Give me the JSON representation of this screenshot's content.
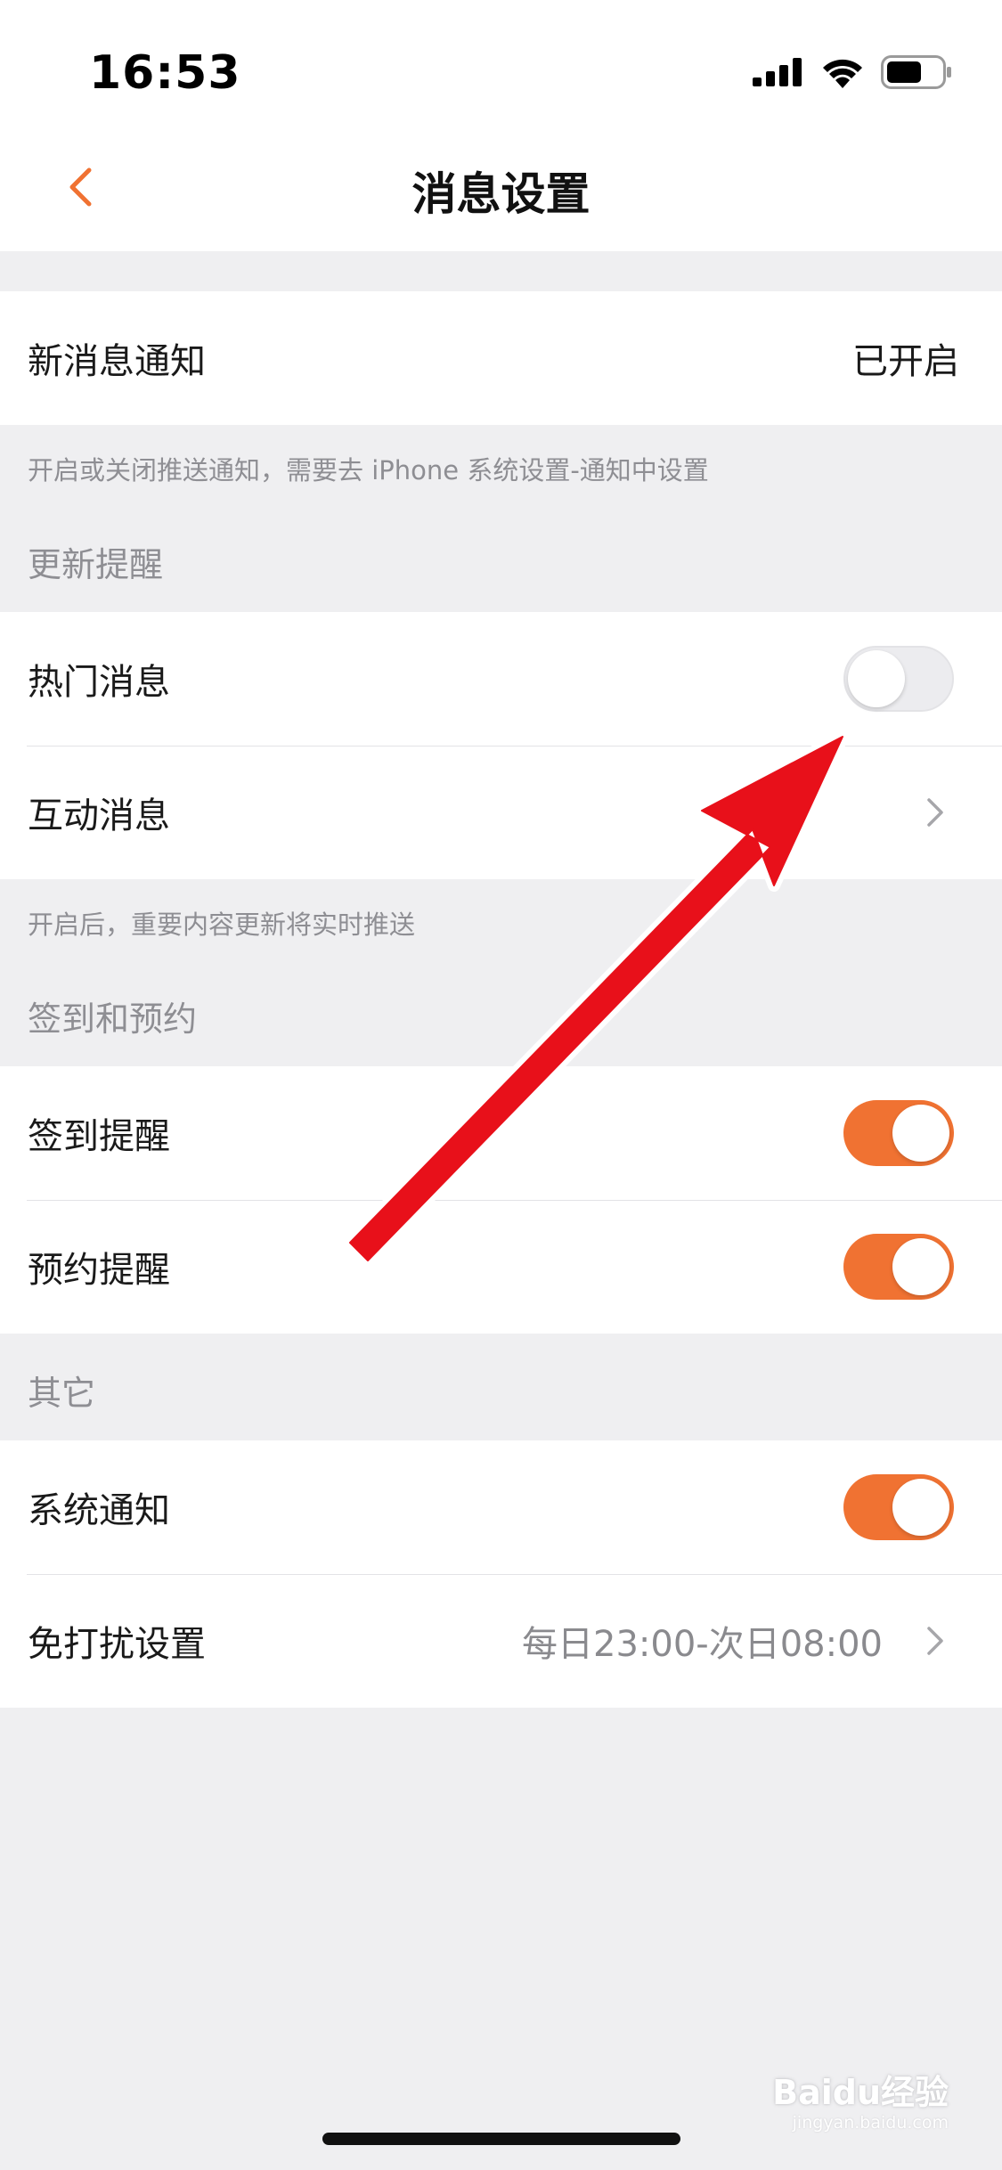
{
  "status_bar": {
    "time": "16:53",
    "icons": [
      "cellular-signal-icon",
      "wifi-icon",
      "battery-icon"
    ]
  },
  "nav": {
    "title": "消息设置",
    "back_icon": "chevron-left-icon"
  },
  "new_message": {
    "label": "新消息通知",
    "value": "已开启",
    "note": "开启或关闭推送通知，需要去 iPhone 系统设置-通知中设置"
  },
  "update_reminders": {
    "header": "更新提醒",
    "items": [
      {
        "label": "热门消息",
        "control": "toggle",
        "on": false
      },
      {
        "label": "互动消息",
        "control": "chevron"
      }
    ],
    "note": "开启后，重要内容更新将实时推送"
  },
  "checkin_booking": {
    "header": "签到和预约",
    "items": [
      {
        "label": "签到提醒",
        "control": "toggle",
        "on": true
      },
      {
        "label": "预约提醒",
        "control": "toggle",
        "on": true
      }
    ]
  },
  "other": {
    "header": "其它",
    "items": [
      {
        "label": "系统通知",
        "control": "toggle",
        "on": true
      },
      {
        "label": "免打扰设置",
        "value": "每日23:00-次日08:00",
        "control": "chevron"
      }
    ]
  },
  "watermark": {
    "text": "Baidu经验",
    "sub": "jingyan.baidu.com"
  },
  "colors": {
    "accent": "#f07232",
    "background": "#efeff1",
    "annotation_arrow": "#e8101a"
  }
}
